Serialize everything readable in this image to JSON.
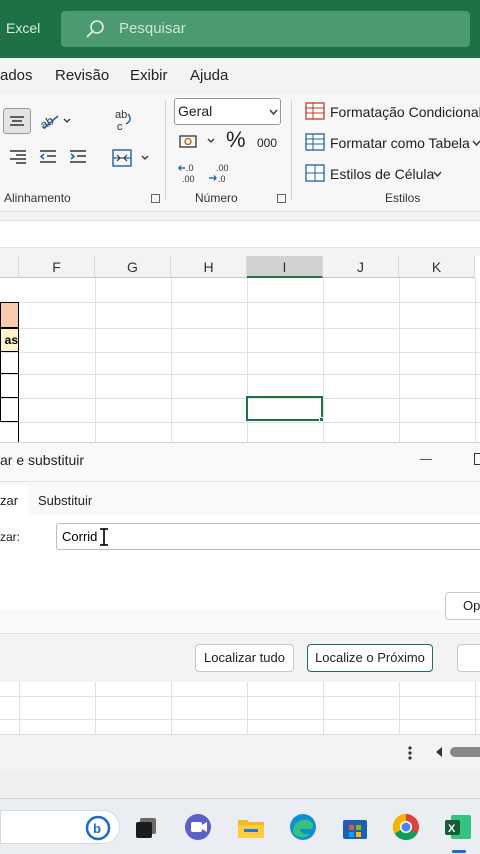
{
  "app": {
    "name": "Excel"
  },
  "search": {
    "placeholder": "Pesquisar"
  },
  "menu": {
    "items": [
      "ados",
      "Revisão",
      "Exibir",
      "Ajuda"
    ]
  },
  "ribbon": {
    "alignment_label": "Alinhamento",
    "number_format": "Geral",
    "percent_symbol": "%",
    "thousands_symbol": "000",
    "number_label": "Número",
    "conditional_formatting": "Formatação Condicional",
    "format_as_table": "Formatar como Tabela",
    "cell_styles": "Estilos de Célula",
    "styles_label": "Estilos"
  },
  "grid": {
    "columns": [
      "F",
      "G",
      "H",
      "I",
      "J",
      "K"
    ],
    "cell_text": "as"
  },
  "dialog": {
    "title": "ar e substituir",
    "tabs": [
      "zar",
      "Substituir"
    ],
    "find_label": "zar:",
    "find_value": "Corrid",
    "options_button": "Op",
    "find_all_button": "Localizar tudo",
    "find_next_button": "Localize o Próximo"
  },
  "colors": {
    "excel_green": "#1e7145",
    "selection_green": "#217346",
    "header_fill": "#f8cbad",
    "yellow_fill": "#fff2cc"
  }
}
